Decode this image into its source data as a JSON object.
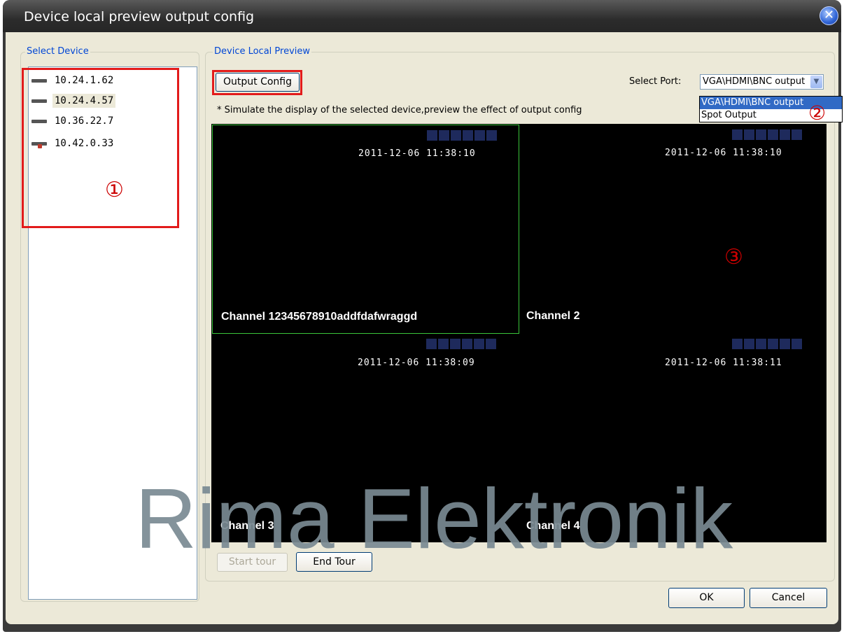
{
  "window": {
    "title": "Device local preview output config"
  },
  "select_device": {
    "legend": "Select Device",
    "devices": [
      {
        "ip": "10.24.1.62",
        "icon": "dvr-device-icon"
      },
      {
        "ip": "10.24.4.57",
        "icon": "dvr-device-icon",
        "selected": true
      },
      {
        "ip": "10.36.22.7",
        "icon": "dvr-device-icon"
      },
      {
        "ip": "10.42.0.33",
        "icon": "dvr-device-warning-icon"
      }
    ]
  },
  "preview": {
    "legend": "Device Local Preview",
    "output_config_label": "Output Config",
    "note": "* Simulate the display of the selected device,preview the effect of  output config",
    "select_port_label": "Select Port:",
    "port_value": "VGA\\HDMI\\BNC output",
    "port_options": [
      "VGA\\HDMI\\BNC output",
      "Spot Output"
    ],
    "channels": [
      {
        "name": "Channel 12345678910addfdafwraggd",
        "timestamp": "2011-12-06 11:38:10"
      },
      {
        "name": "Channel 2",
        "timestamp": "2011-12-06 11:38:10"
      },
      {
        "name": "Channel 3",
        "timestamp": "2011-12-06 11:38:09"
      },
      {
        "name": "Channel 4",
        "timestamp": "2011-12-06 11:38:11"
      }
    ],
    "start_tour_label": "Start tour",
    "end_tour_label": "End Tour"
  },
  "footer": {
    "ok_label": "OK",
    "cancel_label": "Cancel"
  },
  "annotations": {
    "marker_1": "①",
    "marker_2": "②",
    "marker_3": "③"
  },
  "watermark": "Rima Elektronik",
  "colors": {
    "annotation_red": "#e21b1b",
    "selected_cell_border": "#3ac43a",
    "legend_blue": "#0046d5"
  }
}
